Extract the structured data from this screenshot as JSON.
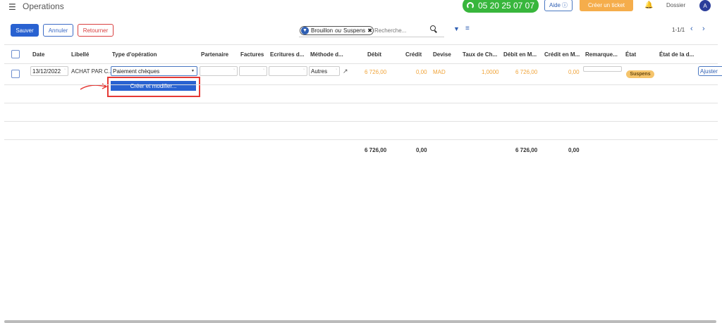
{
  "header": {
    "app_title": "Operations",
    "phone": "05 20 25 07 07",
    "help_label": "Aide",
    "ticket_label": "Créer un ticket",
    "dossier_label": "Dossier",
    "avatar_initial": "A"
  },
  "toolbar": {
    "save_label": "Sauver",
    "cancel_label": "Annuler",
    "return_label": "Retourner"
  },
  "search": {
    "facet_part1": "Brouillon",
    "facet_or": "ou",
    "facet_part2": "Suspens",
    "placeholder": "Recherche..."
  },
  "pager": {
    "range": "1-1/1"
  },
  "columns": [
    "Date",
    "Libellé",
    "Type d'opération",
    "Partenaire",
    "Factures",
    "Ecritures d...",
    "Méthode d...",
    "Débit",
    "Crédit",
    "Devise",
    "Taux de Ch...",
    "Débit en M...",
    "Crédit en M...",
    "Remarque...",
    "État",
    "État de la d..."
  ],
  "row": {
    "date": "13/12/2022",
    "libelle": "ACHAT PAR C...",
    "type_operation": "Paiement chèques",
    "methode": "Autres",
    "debit": "6 726,00",
    "credit": "0,00",
    "devise": "MAD",
    "taux": "1,0000",
    "debit_m": "6 726,00",
    "credit_m": "0,00",
    "etat": "Suspens",
    "ajuster_label": "Ajuster"
  },
  "dropdown": {
    "create_edit": "Créer et modifier..."
  },
  "totals": {
    "debit": "6 726,00",
    "credit": "0,00",
    "debit_m": "6 726,00",
    "credit_m": "0,00"
  },
  "colors": {
    "primary": "#2962d1",
    "accent_orange": "#f5ad4b",
    "phone_green": "#38b63c",
    "danger": "#e53935"
  }
}
